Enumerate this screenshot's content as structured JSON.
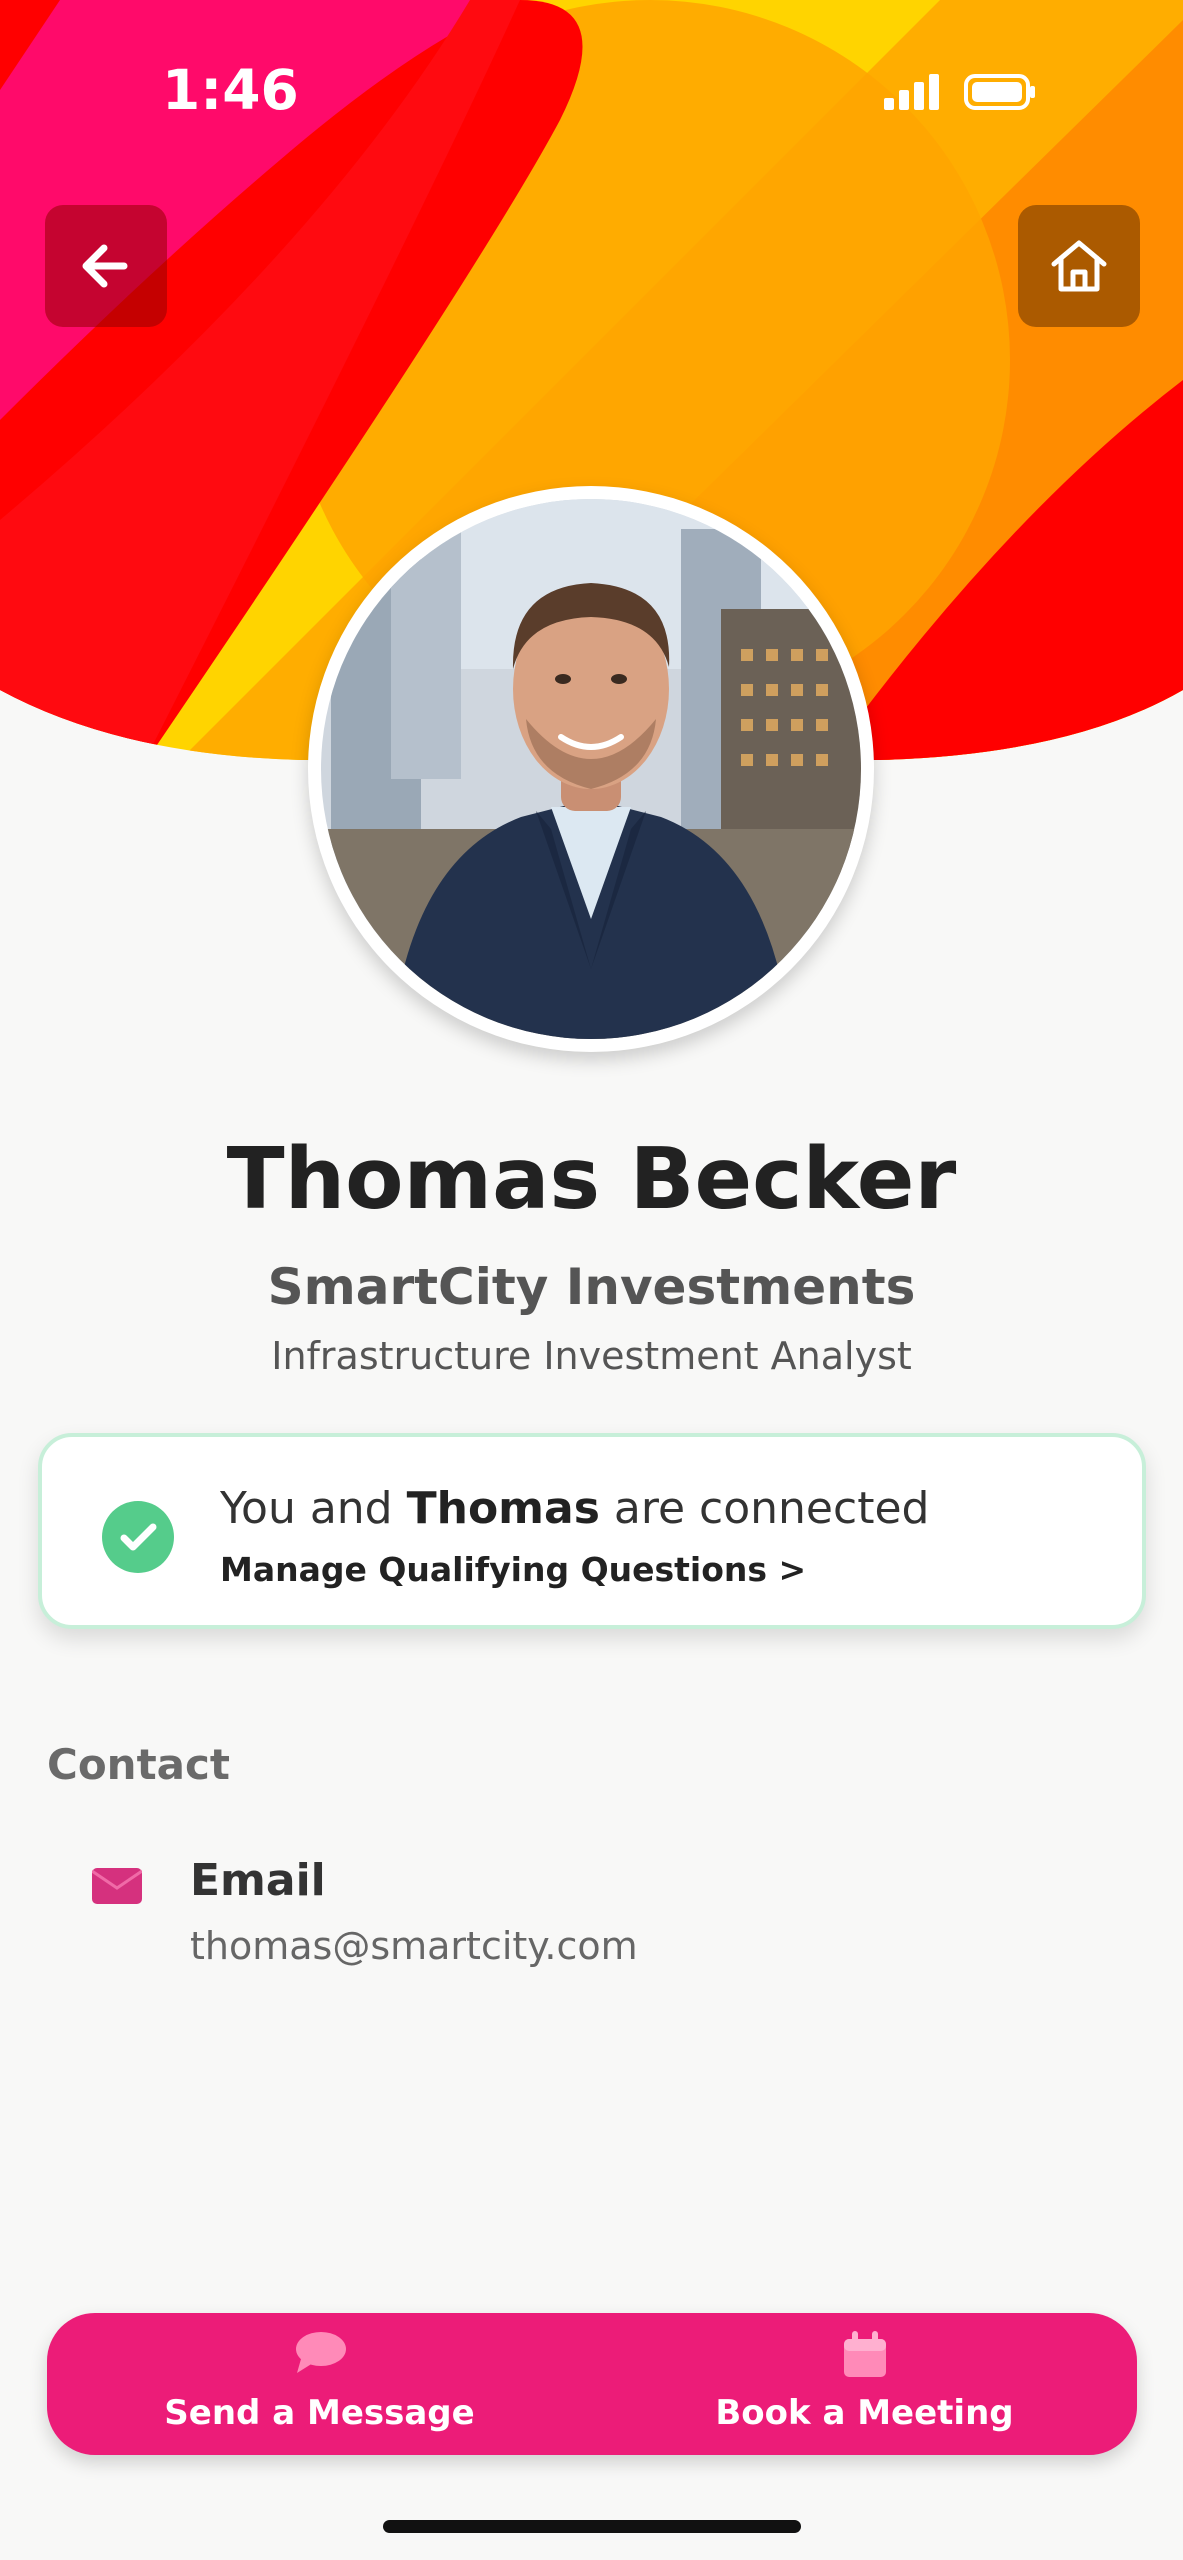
{
  "status_bar": {
    "time": "1:46",
    "icons": [
      "signal-icon",
      "battery-icon"
    ]
  },
  "nav": {
    "back_icon": "arrow-left-icon",
    "home_icon": "home-icon"
  },
  "profile": {
    "name": "Thomas Becker",
    "company": "SmartCity Investments",
    "role": "Infrastructure Investment Analyst"
  },
  "connection": {
    "prefix": "You and",
    "name": "Thomas",
    "suffix": "are connected",
    "manage_link": "Manage Qualifying Questions >",
    "status_color": "#55cc8b"
  },
  "contact": {
    "section_title": "Contact",
    "email_label": "Email",
    "email_value": "thomas@smartcity.com",
    "email_icon": "envelope-icon"
  },
  "actions": {
    "send_message": "Send a Message",
    "book_meeting": "Book a Meeting",
    "message_icon": "chat-bubble-icon",
    "meeting_icon": "calendar-icon",
    "bar_color": "#ec1c78"
  }
}
